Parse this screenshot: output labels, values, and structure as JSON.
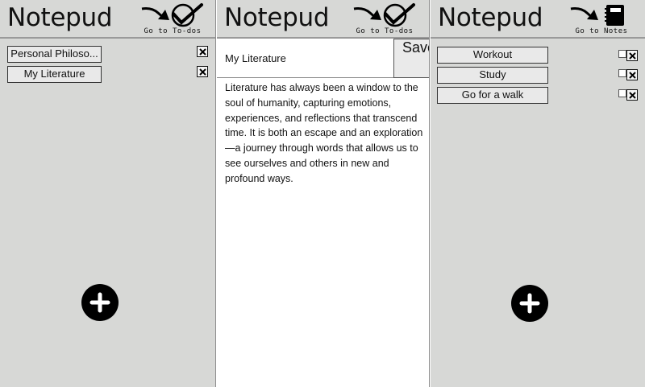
{
  "app": {
    "name": "Notepud"
  },
  "notes_panel": {
    "nav_label": "Go to To-dos",
    "notes": [
      {
        "title": "Personal Philoso..."
      },
      {
        "title": "My Literature"
      }
    ]
  },
  "editor_panel": {
    "nav_label": "Go to To-dos",
    "title_value": "My Literature",
    "save_label": "Save",
    "body_text": "Literature has always been a window to the soul of humanity, capturing emotions, experiences, and reflections that transcend time. It is both an escape and an exploration—a journey through words that allows us to see ourselves and others in new and profound ways."
  },
  "todos_panel": {
    "nav_label": "Go to Notes",
    "todos": [
      {
        "label": "Workout",
        "checked": false
      },
      {
        "label": "Study",
        "checked": false
      },
      {
        "label": "Go for a walk",
        "checked": false
      }
    ]
  },
  "icons": {
    "to_todos": "arrow-checkmark-icon",
    "to_notes": "arrow-notebook-icon",
    "delete": "close-box-icon",
    "add": "plus-circle-icon"
  },
  "colors": {
    "panel_bg": "#d7d8d6",
    "editor_bg": "#ffffff",
    "accent": "#000000"
  }
}
